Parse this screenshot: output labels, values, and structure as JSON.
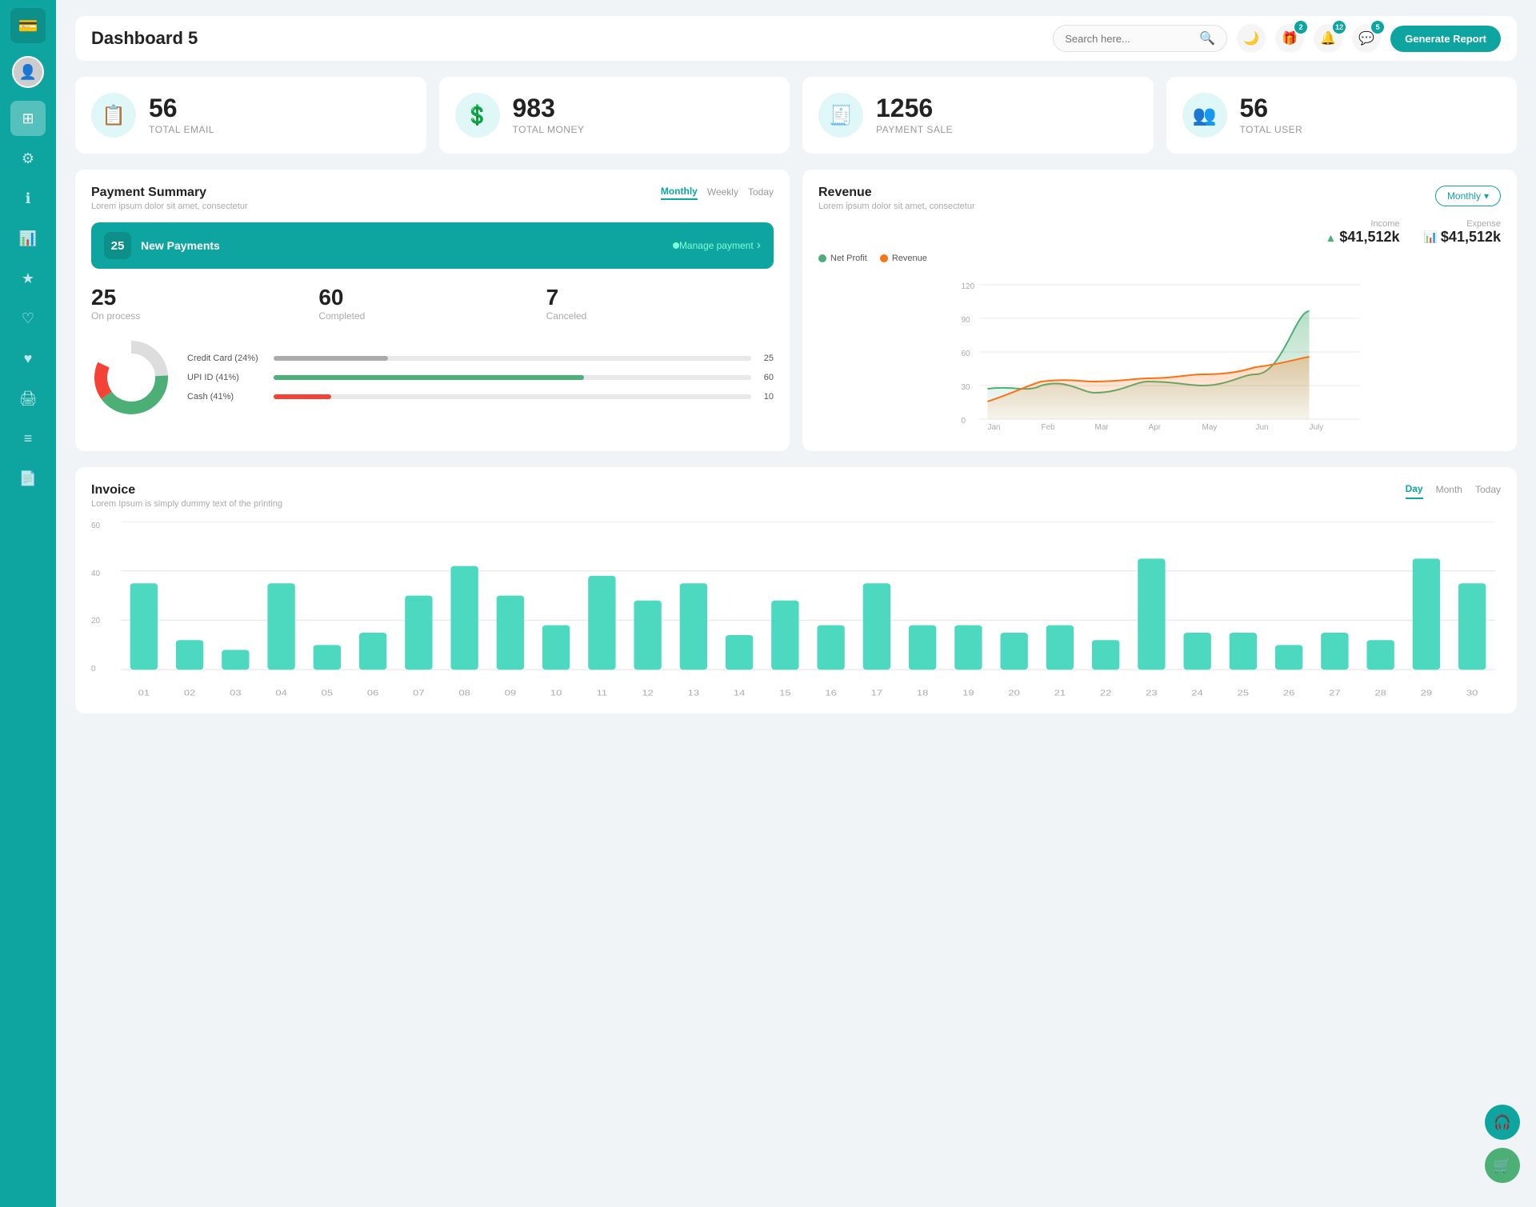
{
  "sidebar": {
    "logo_icon": "💳",
    "items": [
      {
        "id": "home",
        "icon": "⊞",
        "active": true
      },
      {
        "id": "settings",
        "icon": "⚙"
      },
      {
        "id": "info",
        "icon": "ℹ"
      },
      {
        "id": "chart",
        "icon": "📊"
      },
      {
        "id": "star",
        "icon": "★"
      },
      {
        "id": "heart-outline",
        "icon": "♡"
      },
      {
        "id": "heart-fill",
        "icon": "♥"
      },
      {
        "id": "print",
        "icon": "🖨"
      },
      {
        "id": "list",
        "icon": "≡"
      },
      {
        "id": "document",
        "icon": "📄"
      }
    ]
  },
  "header": {
    "title": "Dashboard 5",
    "search_placeholder": "Search here...",
    "badges": {
      "gift": 2,
      "bell": 12,
      "chat": 5
    },
    "generate_btn": "Generate Report"
  },
  "stat_cards": [
    {
      "id": "total-email",
      "value": "56",
      "label": "TOTAL EMAIL",
      "icon": "📋"
    },
    {
      "id": "total-money",
      "value": "983",
      "label": "TOTAL MONEY",
      "icon": "💲"
    },
    {
      "id": "payment-sale",
      "value": "1256",
      "label": "PAYMENT SALE",
      "icon": "🧾"
    },
    {
      "id": "total-user",
      "value": "56",
      "label": "TOTAL USER",
      "icon": "👥"
    }
  ],
  "payment_summary": {
    "title": "Payment Summary",
    "subtitle": "Lorem ipsum dolor sit amet, consectetur",
    "tabs": [
      "Monthly",
      "Weekly",
      "Today"
    ],
    "active_tab": "Monthly",
    "new_payments_count": "25",
    "new_payments_label": "New Payments",
    "manage_link": "Manage payment",
    "stats": [
      {
        "value": "25",
        "label": "On process"
      },
      {
        "value": "60",
        "label": "Completed"
      },
      {
        "value": "7",
        "label": "Canceled"
      }
    ],
    "payment_methods": [
      {
        "label": "Credit Card (24%)",
        "percent": 24,
        "color": "#aaa",
        "value": 25
      },
      {
        "label": "UPI ID (41%)",
        "percent": 41,
        "color": "#4caf76",
        "value": 60
      },
      {
        "label": "Cash (41%)",
        "percent": 10,
        "color": "#f44336",
        "value": 10
      }
    ]
  },
  "revenue": {
    "title": "Revenue",
    "subtitle": "Lorem ipsum dolor sit amet, consectetur",
    "active_tab": "Monthly",
    "income": {
      "label": "Income",
      "value": "$41,512k"
    },
    "expense": {
      "label": "Expense",
      "value": "$41,512k"
    },
    "legend": [
      {
        "label": "Net Profit",
        "color": "#4caf76"
      },
      {
        "label": "Revenue",
        "color": "#f97316"
      }
    ],
    "x_labels": [
      "Jan",
      "Feb",
      "Mar",
      "Apr",
      "May",
      "Jun",
      "July"
    ],
    "y_labels": [
      "0",
      "30",
      "60",
      "90",
      "120"
    ],
    "net_profit_data": [
      28,
      30,
      25,
      35,
      30,
      40,
      95
    ],
    "revenue_data": [
      10,
      28,
      32,
      28,
      35,
      38,
      42
    ]
  },
  "invoice": {
    "title": "Invoice",
    "subtitle": "Lorem Ipsum is simply dummy text of the printing",
    "tabs": [
      "Day",
      "Month",
      "Today"
    ],
    "active_tab": "Day",
    "y_labels": [
      "0",
      "20",
      "40",
      "60"
    ],
    "x_labels": [
      "01",
      "02",
      "03",
      "04",
      "05",
      "06",
      "07",
      "08",
      "09",
      "10",
      "11",
      "12",
      "13",
      "14",
      "15",
      "16",
      "17",
      "18",
      "19",
      "20",
      "21",
      "22",
      "23",
      "24",
      "25",
      "26",
      "27",
      "28",
      "29",
      "30"
    ],
    "bar_data": [
      35,
      12,
      8,
      35,
      10,
      15,
      30,
      42,
      30,
      18,
      38,
      28,
      35,
      14,
      28,
      18,
      35,
      18,
      18,
      15,
      18,
      12,
      45,
      15,
      15,
      10,
      15,
      12,
      45,
      35
    ]
  }
}
